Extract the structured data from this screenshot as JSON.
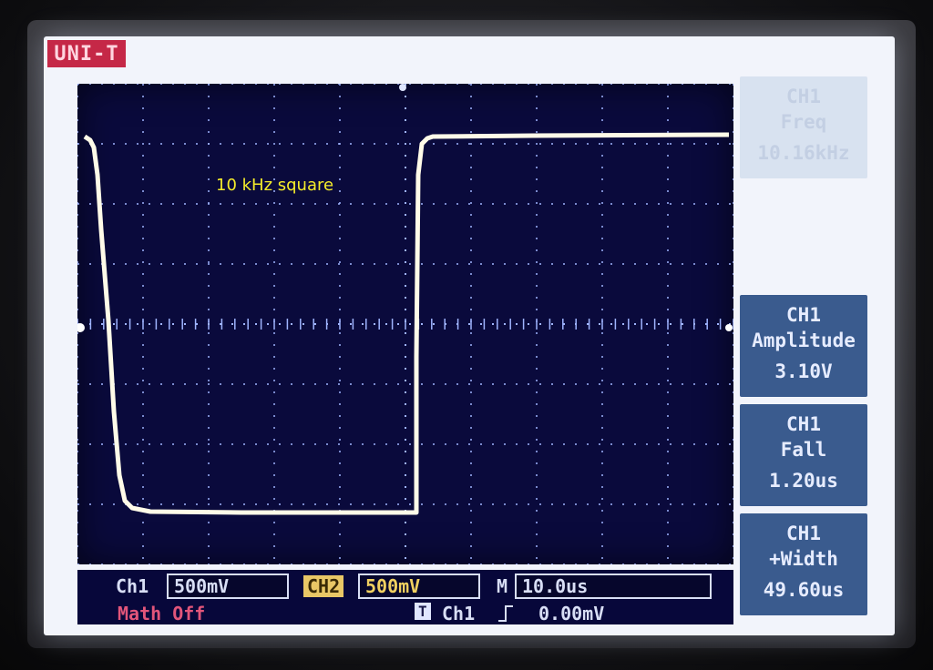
{
  "device": {
    "brand": "UNI-T"
  },
  "annotation": "10 kHz square",
  "measurements": [
    {
      "channel": "CH1",
      "name": "Freq",
      "value": "10.16kHz",
      "faded": true
    },
    {
      "channel": "CH1",
      "name": "Amplitude",
      "value": "3.10V",
      "faded": false
    },
    {
      "channel": "CH1",
      "name": "Fall",
      "value": "1.20us",
      "faded": false
    },
    {
      "channel": "CH1",
      "name": "+Width",
      "value": "49.60us",
      "faded": false
    }
  ],
  "status": {
    "ch1_label": "Ch1",
    "ch1_scale": "500mV",
    "ch2_label": "CH2",
    "ch2_scale": "500mV",
    "timebase_label": "M",
    "timebase": "10.0us",
    "math": "Math Off",
    "trigger_source": "Ch1",
    "trigger_slope_icon": "rising-edge-icon",
    "trigger_level": "0.00mV"
  },
  "colors": {
    "screen_bg": "#0a0a3c",
    "trace": "#fffbe8",
    "grid": "#9fb4ff",
    "annotation": "#f5ec2a",
    "measure_box": "#3a5b8e",
    "brand_bg": "#c52847"
  }
}
